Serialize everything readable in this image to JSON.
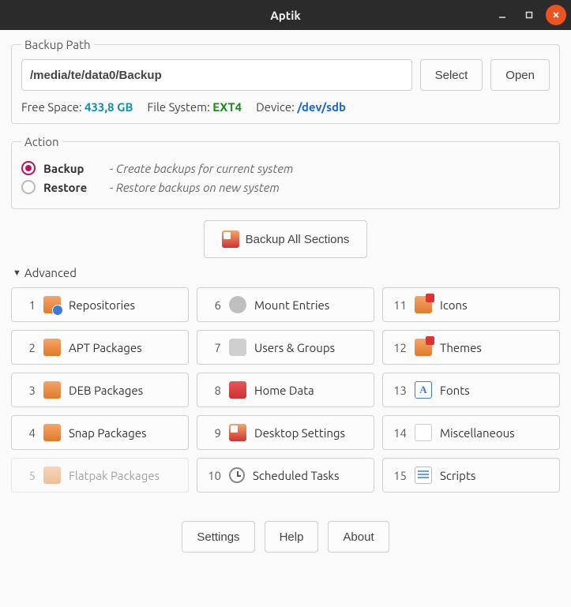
{
  "window": {
    "title": "Aptik"
  },
  "backup_path": {
    "legend": "Backup Path",
    "value": "/media/te/data0/Backup",
    "select_btn": "Select",
    "open_btn": "Open",
    "free_space_label": "Free Space:",
    "free_space_value": "433,8 GB",
    "filesystem_label": "File System:",
    "filesystem_value": "EXT4",
    "device_label": "Device:",
    "device_value": "/dev/sdb"
  },
  "action": {
    "legend": "Action",
    "backup_label": "Backup",
    "backup_desc": "- Create backups for current system",
    "restore_label": "Restore",
    "restore_desc": "- Restore backups on new system",
    "selected": "backup"
  },
  "backup_all_btn": "Backup All Sections",
  "advanced_label": "Advanced",
  "sections": [
    {
      "n": "1",
      "label": "Repositories",
      "icon": "ico-box-globe",
      "disabled": false
    },
    {
      "n": "2",
      "label": "APT Packages",
      "icon": "ico-box-orange",
      "disabled": false
    },
    {
      "n": "3",
      "label": "DEB Packages",
      "icon": "ico-box-orange",
      "disabled": false
    },
    {
      "n": "4",
      "label": "Snap Packages",
      "icon": "ico-box-orange",
      "disabled": false
    },
    {
      "n": "5",
      "label": "Flatpak Packages",
      "icon": "ico-box-orange",
      "disabled": true
    },
    {
      "n": "6",
      "label": "Mount Entries",
      "icon": "ico-disk",
      "disabled": false
    },
    {
      "n": "7",
      "label": "Users & Groups",
      "icon": "ico-users",
      "disabled": false
    },
    {
      "n": "8",
      "label": "Home Data",
      "icon": "ico-folder",
      "disabled": false
    },
    {
      "n": "9",
      "label": "Desktop Settings",
      "icon": "ico-settings",
      "disabled": false
    },
    {
      "n": "10",
      "label": "Scheduled Tasks",
      "icon": "ico-clock",
      "disabled": false
    },
    {
      "n": "11",
      "label": "Icons",
      "icon": "ico-theme",
      "disabled": false
    },
    {
      "n": "12",
      "label": "Themes",
      "icon": "ico-theme",
      "disabled": false
    },
    {
      "n": "13",
      "label": "Fonts",
      "icon": "ico-font",
      "disabled": false
    },
    {
      "n": "14",
      "label": "Miscellaneous",
      "icon": "ico-blank",
      "disabled": false
    },
    {
      "n": "15",
      "label": "Scripts",
      "icon": "ico-script",
      "disabled": false
    }
  ],
  "footer": {
    "settings": "Settings",
    "help": "Help",
    "about": "About"
  },
  "font_glyph": "A"
}
